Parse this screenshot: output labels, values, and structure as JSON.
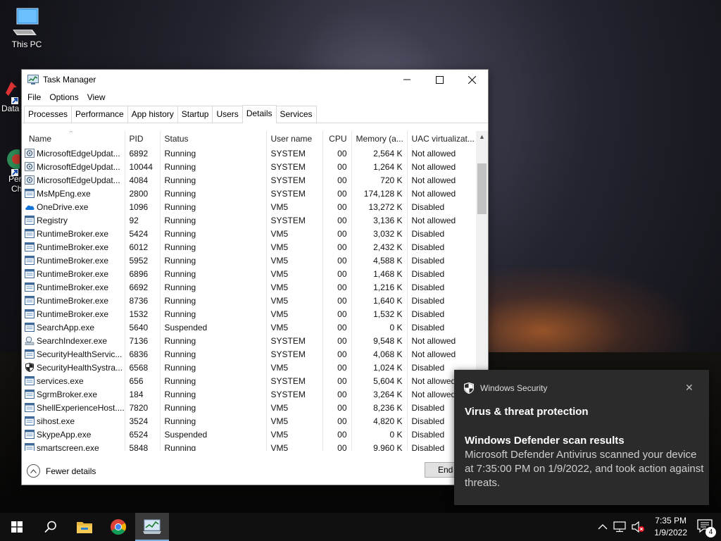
{
  "desktop": {
    "icons": [
      {
        "label": "This PC",
        "icon": "this-pc-icon"
      }
    ],
    "partial_labels": [
      "Data",
      "Per",
      "Ch"
    ]
  },
  "task_manager": {
    "title": "Task Manager",
    "window_buttons": {
      "minimize": "—",
      "maximize": "☐",
      "close": "✕"
    },
    "menu": [
      "File",
      "Options",
      "View"
    ],
    "tabs": [
      "Processes",
      "Performance",
      "App history",
      "Startup",
      "Users",
      "Details",
      "Services"
    ],
    "active_tab": "Details",
    "columns": [
      "Name",
      "PID",
      "Status",
      "User name",
      "CPU",
      "Memory (a...",
      "UAC virtualizat..."
    ],
    "sort_column": "Name",
    "rows": [
      {
        "icon": "edge-update-icon",
        "name": "MicrosoftEdgeUpdat...",
        "pid": "6892",
        "status": "Running",
        "user": "SYSTEM",
        "cpu": "00",
        "memory": "2,564 K",
        "uac": "Not allowed"
      },
      {
        "icon": "edge-update-icon",
        "name": "MicrosoftEdgeUpdat...",
        "pid": "10044",
        "status": "Running",
        "user": "SYSTEM",
        "cpu": "00",
        "memory": "1,264 K",
        "uac": "Not allowed"
      },
      {
        "icon": "edge-update-icon",
        "name": "MicrosoftEdgeUpdat...",
        "pid": "4084",
        "status": "Running",
        "user": "SYSTEM",
        "cpu": "00",
        "memory": "720 K",
        "uac": "Not allowed"
      },
      {
        "icon": "process-icon",
        "name": "MsMpEng.exe",
        "pid": "2800",
        "status": "Running",
        "user": "SYSTEM",
        "cpu": "00",
        "memory": "174,128 K",
        "uac": "Not allowed"
      },
      {
        "icon": "onedrive-icon",
        "name": "OneDrive.exe",
        "pid": "1096",
        "status": "Running",
        "user": "VM5",
        "cpu": "00",
        "memory": "13,272 K",
        "uac": "Disabled"
      },
      {
        "icon": "process-icon",
        "name": "Registry",
        "pid": "92",
        "status": "Running",
        "user": "SYSTEM",
        "cpu": "00",
        "memory": "3,136 K",
        "uac": "Not allowed"
      },
      {
        "icon": "process-icon",
        "name": "RuntimeBroker.exe",
        "pid": "5424",
        "status": "Running",
        "user": "VM5",
        "cpu": "00",
        "memory": "3,032 K",
        "uac": "Disabled"
      },
      {
        "icon": "process-icon",
        "name": "RuntimeBroker.exe",
        "pid": "6012",
        "status": "Running",
        "user": "VM5",
        "cpu": "00",
        "memory": "2,432 K",
        "uac": "Disabled"
      },
      {
        "icon": "process-icon",
        "name": "RuntimeBroker.exe",
        "pid": "5952",
        "status": "Running",
        "user": "VM5",
        "cpu": "00",
        "memory": "4,588 K",
        "uac": "Disabled"
      },
      {
        "icon": "process-icon",
        "name": "RuntimeBroker.exe",
        "pid": "6896",
        "status": "Running",
        "user": "VM5",
        "cpu": "00",
        "memory": "1,468 K",
        "uac": "Disabled"
      },
      {
        "icon": "process-icon",
        "name": "RuntimeBroker.exe",
        "pid": "6692",
        "status": "Running",
        "user": "VM5",
        "cpu": "00",
        "memory": "1,216 K",
        "uac": "Disabled"
      },
      {
        "icon": "process-icon",
        "name": "RuntimeBroker.exe",
        "pid": "8736",
        "status": "Running",
        "user": "VM5",
        "cpu": "00",
        "memory": "1,640 K",
        "uac": "Disabled"
      },
      {
        "icon": "process-icon",
        "name": "RuntimeBroker.exe",
        "pid": "1532",
        "status": "Running",
        "user": "VM5",
        "cpu": "00",
        "memory": "1,532 K",
        "uac": "Disabled"
      },
      {
        "icon": "process-icon",
        "name": "SearchApp.exe",
        "pid": "5640",
        "status": "Suspended",
        "user": "VM5",
        "cpu": "00",
        "memory": "0 K",
        "uac": "Disabled"
      },
      {
        "icon": "search-indexer-icon",
        "name": "SearchIndexer.exe",
        "pid": "7136",
        "status": "Running",
        "user": "SYSTEM",
        "cpu": "00",
        "memory": "9,548 K",
        "uac": "Not allowed"
      },
      {
        "icon": "process-icon",
        "name": "SecurityHealthServic...",
        "pid": "6836",
        "status": "Running",
        "user": "SYSTEM",
        "cpu": "00",
        "memory": "4,068 K",
        "uac": "Not allowed"
      },
      {
        "icon": "shield-icon",
        "name": "SecurityHealthSystra...",
        "pid": "6568",
        "status": "Running",
        "user": "VM5",
        "cpu": "00",
        "memory": "1,024 K",
        "uac": "Disabled"
      },
      {
        "icon": "process-icon",
        "name": "services.exe",
        "pid": "656",
        "status": "Running",
        "user": "SYSTEM",
        "cpu": "00",
        "memory": "5,604 K",
        "uac": "Not allowed"
      },
      {
        "icon": "process-icon",
        "name": "SgrmBroker.exe",
        "pid": "184",
        "status": "Running",
        "user": "SYSTEM",
        "cpu": "00",
        "memory": "3,264 K",
        "uac": "Not allowed"
      },
      {
        "icon": "process-icon",
        "name": "ShellExperienceHost....",
        "pid": "7820",
        "status": "Running",
        "user": "VM5",
        "cpu": "00",
        "memory": "8,236 K",
        "uac": "Disabled"
      },
      {
        "icon": "process-icon",
        "name": "sihost.exe",
        "pid": "3524",
        "status": "Running",
        "user": "VM5",
        "cpu": "00",
        "memory": "4,820 K",
        "uac": "Disabled"
      },
      {
        "icon": "process-icon",
        "name": "SkypeApp.exe",
        "pid": "6524",
        "status": "Suspended",
        "user": "VM5",
        "cpu": "00",
        "memory": "0 K",
        "uac": "Disabled"
      },
      {
        "icon": "process-icon",
        "name": "smartscreen.exe",
        "pid": "5848",
        "status": "Running",
        "user": "VM5",
        "cpu": "00",
        "memory": "9,960 K",
        "uac": "Disabled"
      }
    ],
    "footer": {
      "fewer_details": "Fewer details",
      "end_button": "End"
    }
  },
  "toast": {
    "app_name": "Windows Security",
    "close": "✕",
    "heading": "Virus & threat protection",
    "title": "Windows Defender scan results",
    "body": "Microsoft Defender Antivirus scanned your device at 7:35:00 PM on 1/9/2022, and took action against threats."
  },
  "taskbar": {
    "apps": [
      "start-icon",
      "search-icon",
      "file-explorer-icon",
      "chrome-icon",
      "task-manager-icon"
    ],
    "active_app": "task-manager-icon",
    "tray_icons": [
      "chevron-up-icon",
      "network-icon",
      "volume-muted-icon"
    ],
    "time": "7:35 PM",
    "date": "1/9/2022",
    "notification_count": "4"
  },
  "colors": {
    "accent": "#7fb0e0",
    "toast_bg": "#2b2b2b",
    "taskbar_bg": "#101010"
  }
}
